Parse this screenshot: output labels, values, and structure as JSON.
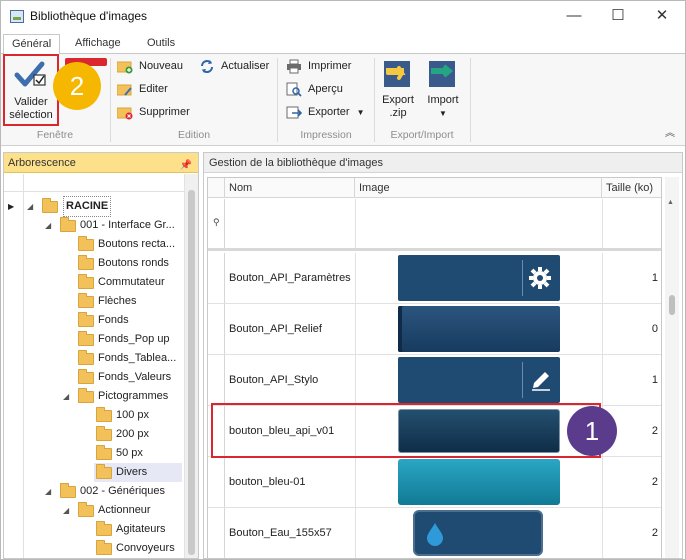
{
  "window": {
    "title": "Bibliothèque d'images",
    "minimize_glyph": "—",
    "maximize_glyph": "☐",
    "close_glyph": "✕"
  },
  "ribbon": {
    "tabs": [
      {
        "label": "Général",
        "active": true
      },
      {
        "label": "Affichage",
        "active": false
      },
      {
        "label": "Outils",
        "active": false
      }
    ],
    "groups": {
      "fenetre": {
        "label": "Fenêtre",
        "valider_line1": "Valider",
        "valider_line2": "sélection"
      },
      "edition": {
        "label": "Edition",
        "nouveau": "Nouveau",
        "editer": "Editer",
        "supprimer": "Supprimer",
        "actualiser": "Actualiser"
      },
      "impression": {
        "label": "Impression",
        "imprimer": "Imprimer",
        "apercu": "Aperçu",
        "exporter": "Exporter"
      },
      "export_import": {
        "label": "Export/Import",
        "export_line1": "Export",
        "export_line2": ".zip",
        "import": "Import"
      }
    },
    "collapse_glyph": "︽"
  },
  "callouts": {
    "one": "1",
    "two": "2",
    "color": "#5b3c8c",
    "color2": "#f5b700"
  },
  "tree_panel": {
    "title": "Arborescence",
    "items": [
      {
        "label": "RACINE",
        "bold": true
      },
      {
        "label": "001 - Interface Gr..."
      },
      {
        "label": "Boutons recta..."
      },
      {
        "label": "Boutons ronds"
      },
      {
        "label": "Commutateur"
      },
      {
        "label": "Flèches"
      },
      {
        "label": "Fonds"
      },
      {
        "label": "Fonds_Pop up"
      },
      {
        "label": "Fonds_Tablea..."
      },
      {
        "label": "Fonds_Valeurs"
      },
      {
        "label": "Pictogrammes"
      },
      {
        "label": "100 px"
      },
      {
        "label": "200 px"
      },
      {
        "label": "50 px"
      },
      {
        "label": "Divers",
        "selected": true
      },
      {
        "label": "002 - Génériques"
      },
      {
        "label": "Actionneur"
      },
      {
        "label": "Agitateurs"
      },
      {
        "label": "Convoyeurs"
      }
    ]
  },
  "grid_panel": {
    "title": "Gestion de la bibliothèque d'images",
    "columns": {
      "name": "Nom",
      "image": "Image",
      "size": "Taille (ko)"
    },
    "rows": [
      {
        "name": "Bouton_API_Paramètres",
        "size": "1",
        "icon": "gear-icon"
      },
      {
        "name": "Bouton_API_Relief",
        "size": "0",
        "icon": "none"
      },
      {
        "name": "Bouton_API_Stylo",
        "size": "1",
        "icon": "pencil-icon"
      },
      {
        "name": "bouton_bleu_api_v01",
        "size": "2",
        "icon": "none",
        "highlighted": true
      },
      {
        "name": "bouton_bleu-01",
        "size": "2",
        "icon": "none"
      },
      {
        "name": "Bouton_Eau_155x57",
        "size": "2",
        "icon": "water-drop-icon"
      }
    ]
  },
  "colors": {
    "highlight_red": "#d9262f",
    "tree_header": "#fde18a",
    "button_navy": "#1e4468",
    "button_teal": "#1a8fae"
  }
}
